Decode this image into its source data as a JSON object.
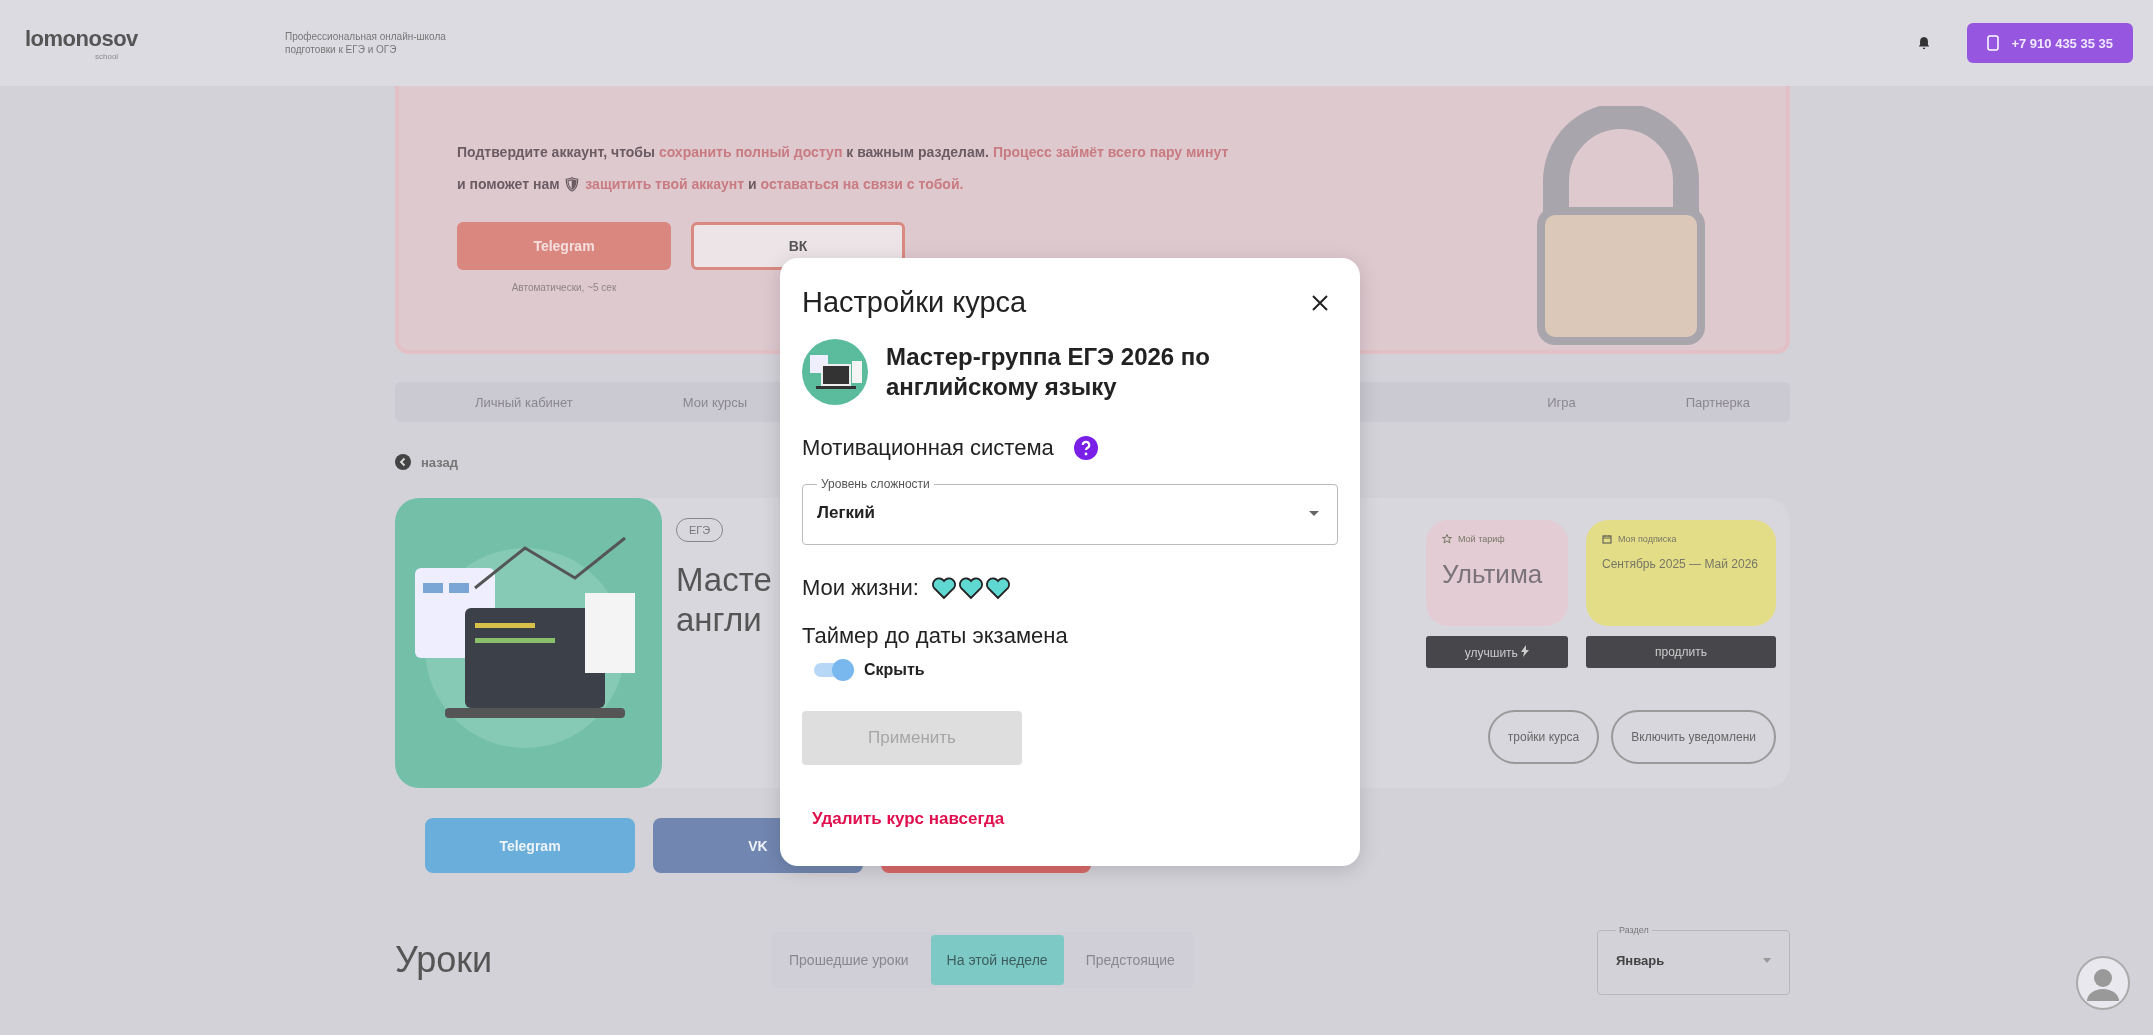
{
  "header": {
    "logo": "lomonosov",
    "logo_sub": "school",
    "tagline": "Профессиональная онлайн-школа подготовки к ЕГЭ и ОГЭ",
    "phone": "+7 910 435 35 35"
  },
  "verify_banner": {
    "text": "Подтвердите аккаунт, чтобы **сохранить полный доступ** к важным разделам. **Процесс займёт всего пару минут** и поможет нам 🛡 **защитить твой аккаунт** и **оставаться на связи с тобой.**",
    "buttons": [
      {
        "label": "Telegram",
        "kind": "filled",
        "caption": "Автоматически, ~5 сек"
      },
      {
        "label": "ВК",
        "kind": "outline"
      }
    ]
  },
  "nav": {
    "left": [
      "Личный кабинет",
      "Мои курсы"
    ],
    "right": [
      "Игра",
      "Партнерка"
    ]
  },
  "back": "назад",
  "course": {
    "tags": [
      "ЕГЭ"
    ],
    "title_lines": [
      "Масте",
      "англи"
    ],
    "tariff": {
      "label": "Мой тариф",
      "value": "Ультима",
      "action": "улучшить"
    },
    "subscription": {
      "label": "Моя подписка",
      "value": "Сентябрь 2025 — Май 2026",
      "action": "продлить"
    },
    "actions": [
      "тройки курса",
      "Включить уведомлени"
    ],
    "links": [
      {
        "label": "Telegram",
        "color": "#6aaedc"
      },
      {
        "label": "VK",
        "color": "#7186b0"
      },
      {
        "color": "#d96a6a"
      }
    ]
  },
  "lessons": {
    "title": "Уроки",
    "tabs": [
      {
        "label": "Прошедшие уроки",
        "selected": false
      },
      {
        "label": "На этой неделе",
        "selected": true
      },
      {
        "label": "Предстоящие",
        "selected": false
      }
    ],
    "section_select": {
      "label": "Раздел",
      "value": "Январь"
    }
  },
  "modal": {
    "title": "Настройки курса",
    "course_name": "Мастер-группа ЕГЭ 2026 по английскому языку",
    "motivation_label": "Мотивационная система",
    "difficulty": {
      "label": "Уровень сложности",
      "value": "Легкий"
    },
    "lives_label": "Мои жизни:",
    "hearts": [
      {
        "filled": true
      },
      {
        "filled": true
      },
      {
        "filled": true
      }
    ],
    "timer_label": "Таймер до даты экзамена",
    "timer_toggle": {
      "label": "Скрыть",
      "on": true
    },
    "apply_button": {
      "label": "Применить",
      "disabled": true
    },
    "delete_link": "Удалить курс навсегда"
  }
}
